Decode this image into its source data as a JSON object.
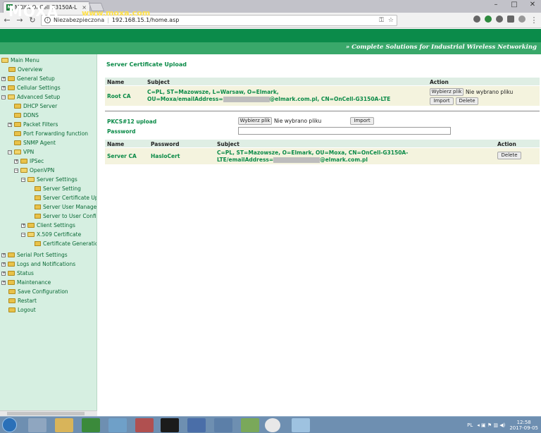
{
  "browser": {
    "tab_title": "MOXA OnCell G3150A-L",
    "tab_close": "×",
    "address": {
      "security_label": "Niezabezpieczona",
      "url": "192.168.15.1/home.asp"
    },
    "window_controls": [
      "–",
      "□",
      "✕"
    ]
  },
  "header": {
    "logo": "MOXA",
    "site": "www.moxa.com",
    "slogan": "» Complete Solutions for Industrial Wireless Networking"
  },
  "sidebar": {
    "items": [
      {
        "label": "Main Menu"
      },
      {
        "label": "Overview"
      },
      {
        "label": "General Setup"
      },
      {
        "label": "Cellular Settings"
      },
      {
        "label": "Advanced Setup"
      },
      {
        "label": "DHCP Server"
      },
      {
        "label": "DDNS"
      },
      {
        "label": "Packet Filters"
      },
      {
        "label": "Port Forwarding function"
      },
      {
        "label": "SNMP Agent"
      },
      {
        "label": "VPN"
      },
      {
        "label": "IPSec"
      },
      {
        "label": "OpenVPN"
      },
      {
        "label": "Server Settings"
      },
      {
        "label": "Server Setting"
      },
      {
        "label": "Server Certificate Up"
      },
      {
        "label": "Server User Manager"
      },
      {
        "label": "Server to User Confi"
      },
      {
        "label": "Client Settings"
      },
      {
        "label": "X.509 Certificate"
      },
      {
        "label": "Certificate Generatio"
      },
      {
        "label": "Serial Port Settings"
      },
      {
        "label": "Logs and Notifications"
      },
      {
        "label": "Status"
      },
      {
        "label": "Maintenance"
      },
      {
        "label": "Save Configuration"
      },
      {
        "label": "Restart"
      },
      {
        "label": "Logout"
      }
    ]
  },
  "main": {
    "title": "Server Certificate Upload",
    "ca_table": {
      "headers": [
        "Name",
        "Subject",
        "Action"
      ],
      "row": {
        "name": "Root CA",
        "subject_line1": "C=PL, ST=Mazowsze, L=Warsaw, O=Elmark,",
        "subject_line2_prefix": "OU=Moxa/emailAddress=",
        "subject_line2_suffix": "@elmark.com.pl, CN=OnCell-G3150A-LTE",
        "choose_file": "Wybierz plik",
        "no_file": "Nie wybrano pliku",
        "import": "Import",
        "delete": "Delete"
      }
    },
    "pkcs": {
      "label": "PKCS#12 upload",
      "choose_file": "Wybierz plik",
      "no_file": "Nie wybrano pliku",
      "import": "Import",
      "password_label": "Password",
      "password_value": ""
    },
    "server_table": {
      "headers": [
        "Name",
        "Password",
        "Subject",
        "Action"
      ],
      "row": {
        "name": "Server CA",
        "password": "HasloCert",
        "subject_line1": "C=PL, ST=Mazowsze, O=Elmark, OU=Moxa, CN=OnCell-G3150A-",
        "subject_line2_prefix": "LTE/emailAddress=",
        "subject_line2_suffix": "@elmark.com.pl",
        "delete": "Delete"
      }
    }
  },
  "taskbar": {
    "lang": "PL",
    "time": "12:58",
    "date": "2017-09-05"
  },
  "colors": {
    "brand_green": "#0b8b4a",
    "brand_yellow": "#ffe14a",
    "sidebar_bg": "#d6efe1",
    "row_bg": "#f4f3de"
  }
}
